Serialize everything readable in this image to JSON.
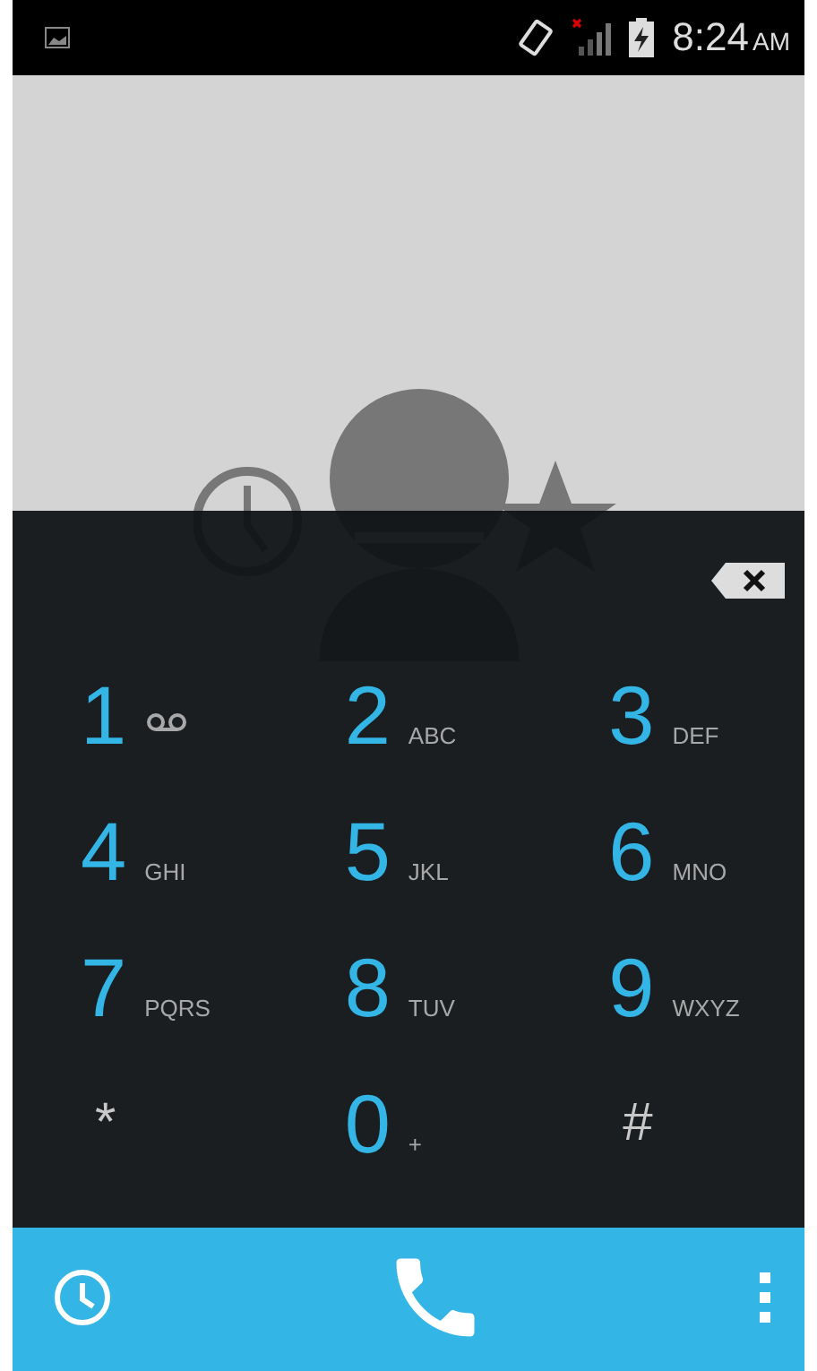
{
  "status_bar": {
    "time": "8:24",
    "period": "AM"
  },
  "keys": [
    {
      "kind": "voicemail",
      "digit": "1"
    },
    {
      "kind": "letters",
      "digit": "2",
      "letters": "ABC"
    },
    {
      "kind": "letters",
      "digit": "3",
      "letters": "DEF"
    },
    {
      "kind": "letters",
      "digit": "4",
      "letters": "GHI"
    },
    {
      "kind": "letters",
      "digit": "5",
      "letters": "JKL"
    },
    {
      "kind": "letters",
      "digit": "6",
      "letters": "MNO"
    },
    {
      "kind": "letters",
      "digit": "7",
      "letters": "PQRS"
    },
    {
      "kind": "letters",
      "digit": "8",
      "letters": "TUV"
    },
    {
      "kind": "letters",
      "digit": "9",
      "letters": "WXYZ"
    },
    {
      "kind": "symbol",
      "digit": "*"
    },
    {
      "kind": "letters",
      "digit": "0",
      "letters": "+"
    },
    {
      "kind": "symbol",
      "digit": "#"
    }
  ]
}
